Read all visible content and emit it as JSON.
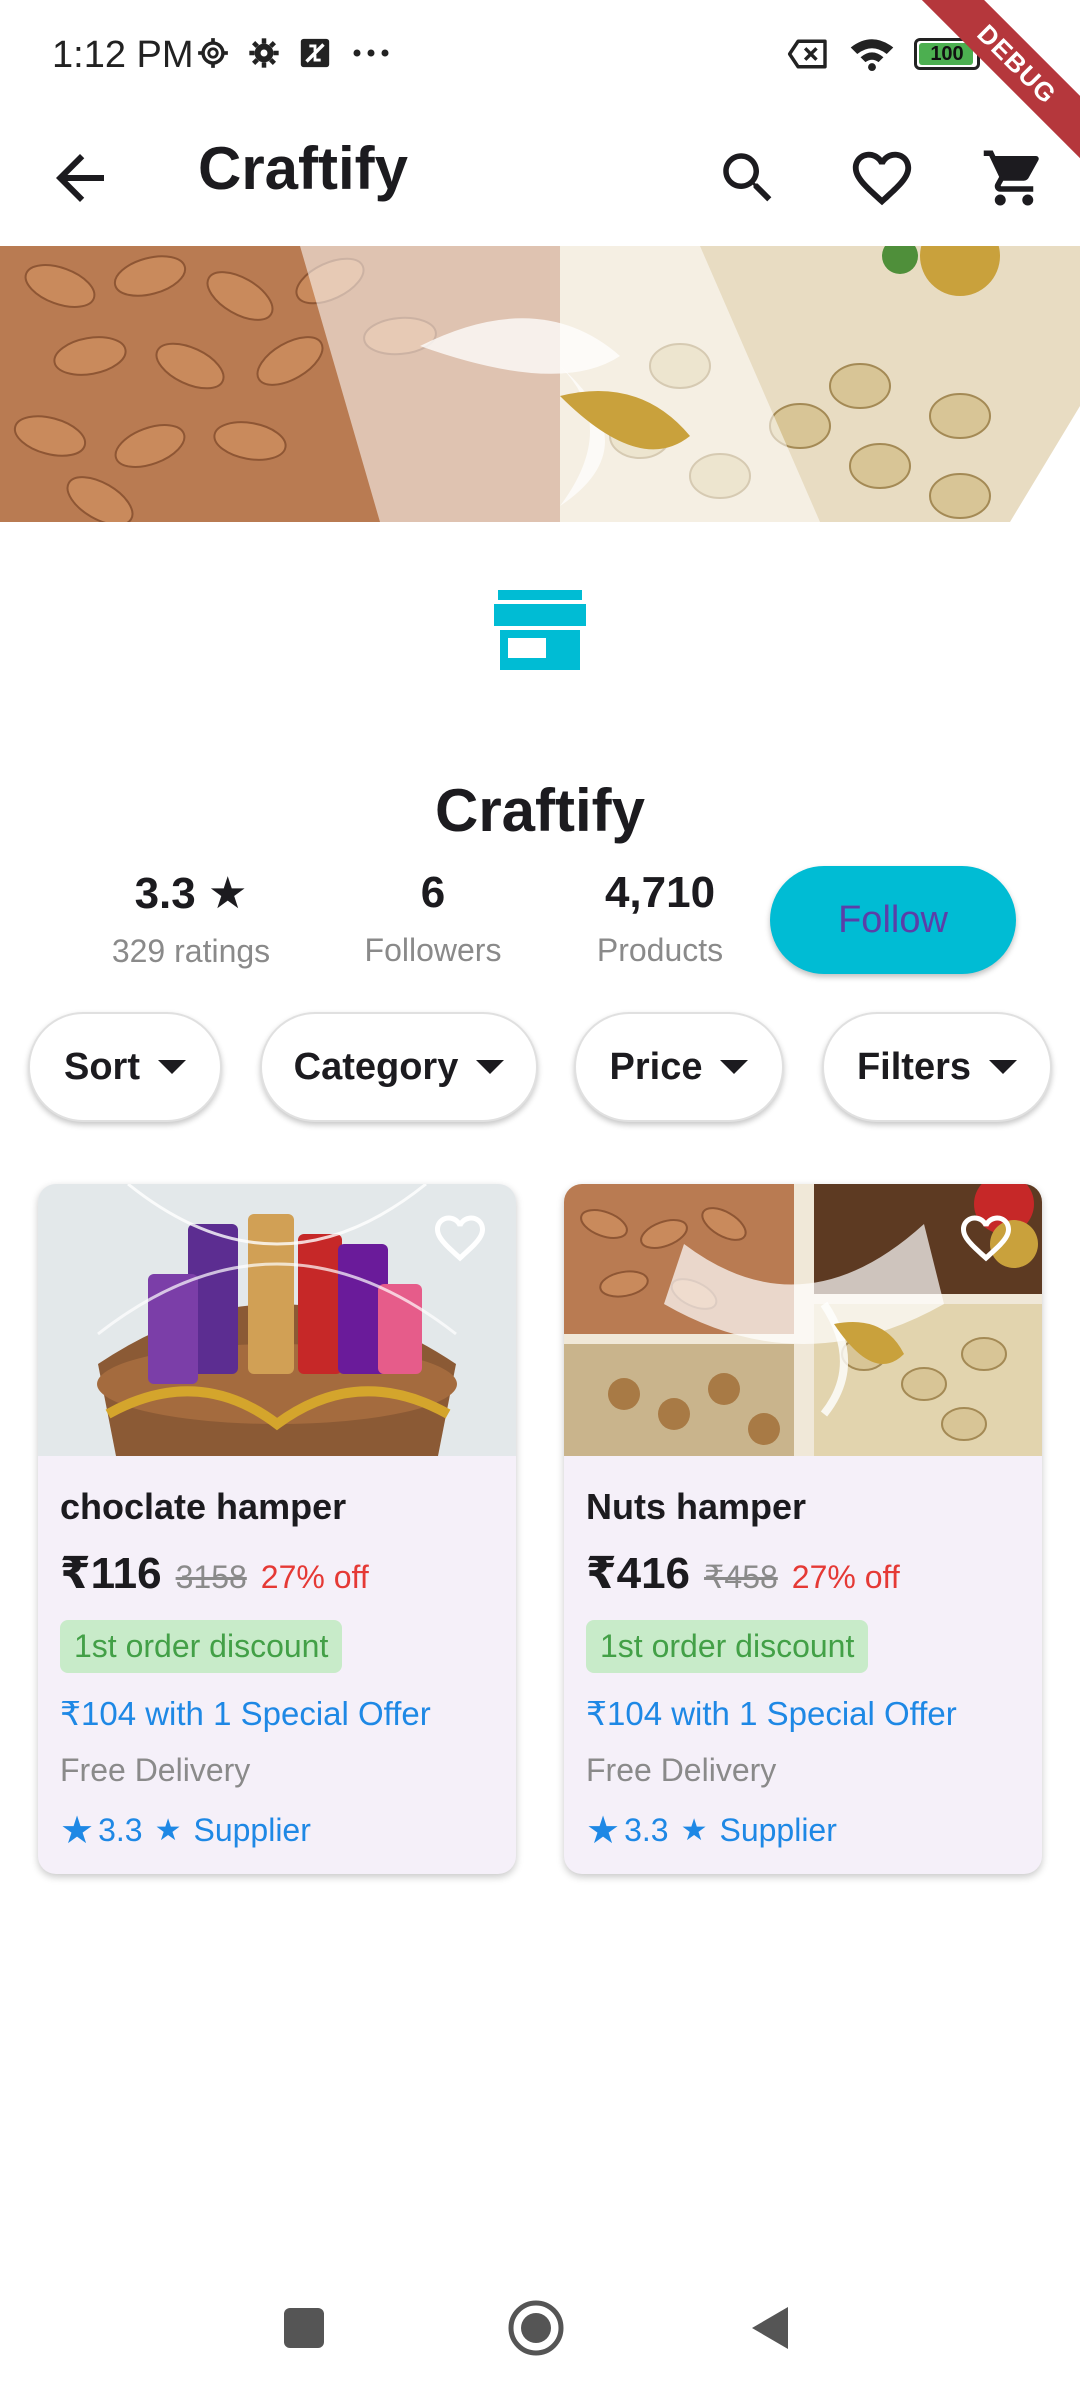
{
  "status_bar": {
    "time": "1:12 PM",
    "battery": "100",
    "debug_label": "DEBUG",
    "icons": [
      "gear-outline-icon",
      "gear-icon",
      "sim-blocked-icon",
      "more-dots-icon",
      "no-sim-icon",
      "wifi-icon",
      "battery-icon"
    ]
  },
  "app_bar": {
    "title": "Craftify",
    "actions": [
      "search-icon",
      "heart-outline-icon",
      "cart-icon"
    ]
  },
  "store": {
    "name": "Craftify",
    "rating_value": "3.3",
    "rating_label": "329 ratings",
    "followers_value": "6",
    "followers_label": "Followers",
    "products_value": "4,710",
    "products_label": "Products",
    "follow_label": "Follow"
  },
  "filters": [
    {
      "label": "Sort"
    },
    {
      "label": "Category"
    },
    {
      "label": "Price"
    },
    {
      "label": "Filters"
    }
  ],
  "products": [
    {
      "title": "choclate hamper",
      "price": "₹116",
      "original_price": "3158",
      "discount": "27% off",
      "badge": "1st order discount",
      "special_offer": "₹104 with 1 Special Offer",
      "delivery": "Free Delivery",
      "rating": "3.3",
      "supplier_label": "Supplier"
    },
    {
      "title": "Nuts hamper",
      "price": "₹416",
      "original_price": "₹458",
      "discount": "27% off",
      "badge": "1st order discount",
      "special_offer": "₹104 with 1 Special Offer",
      "delivery": "Free Delivery",
      "rating": "3.3",
      "supplier_label": "Supplier"
    }
  ],
  "colors": {
    "accent": "#00bcd4",
    "follow_text": "#5b3fa8",
    "discount_red": "#e53935",
    "badge_bg": "#c8ebc9",
    "badge_text": "#43a047",
    "link_blue": "#1e88e5",
    "card_bg": "#f5f0f9"
  }
}
